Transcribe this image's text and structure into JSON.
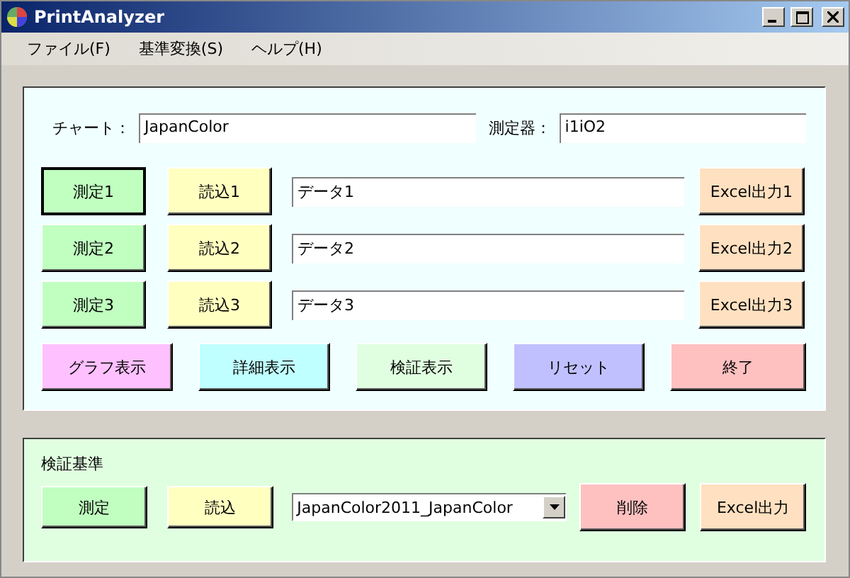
{
  "window": {
    "title": "PrintAnalyzer"
  },
  "menu": [
    "ファイル(F)",
    "基準変換(S)",
    "ヘルプ(H)"
  ],
  "chart_field": {
    "label": "チャート：",
    "value": "JapanColor"
  },
  "device_field": {
    "label": "測定器：",
    "value": "i1iO2"
  },
  "rows": [
    {
      "measure": {
        "label": "測定1",
        "color": "#c0ffc0",
        "focused": true
      },
      "read": {
        "label": "読込1",
        "color": "#ffffc0"
      },
      "data": "データ1",
      "excel": {
        "label": "Excel出力1",
        "color": "#ffe0c0"
      }
    },
    {
      "measure": {
        "label": "測定2",
        "color": "#c0ffc0",
        "focused": false
      },
      "read": {
        "label": "読込2",
        "color": "#ffffc0"
      },
      "data": "データ2",
      "excel": {
        "label": "Excel出力2",
        "color": "#ffe0c0"
      }
    },
    {
      "measure": {
        "label": "測定3",
        "color": "#c0ffc0",
        "focused": false
      },
      "read": {
        "label": "読込3",
        "color": "#ffffc0"
      },
      "data": "データ3",
      "excel": {
        "label": "Excel出力3",
        "color": "#ffe0c0"
      }
    }
  ],
  "actions": [
    {
      "label": "グラフ表示",
      "color": "#ffc0ff"
    },
    {
      "label": "詳細表示",
      "color": "#c0ffff"
    },
    {
      "label": "検証表示",
      "color": "#e0ffe0"
    },
    {
      "label": "リセット",
      "color": "#c0c0ff"
    },
    {
      "label": "終了",
      "color": "#ffc0c0"
    }
  ],
  "standard": {
    "title": "検証基準",
    "measure": {
      "label": "測定",
      "color": "#c0ffc0"
    },
    "read": {
      "label": "読込",
      "color": "#ffffc0"
    },
    "select": "JapanColor2011_JapanColor",
    "delete": {
      "label": "削除",
      "color": "#ffc0c0"
    },
    "excel": {
      "label": "Excel出力",
      "color": "#ffe0c0"
    }
  }
}
